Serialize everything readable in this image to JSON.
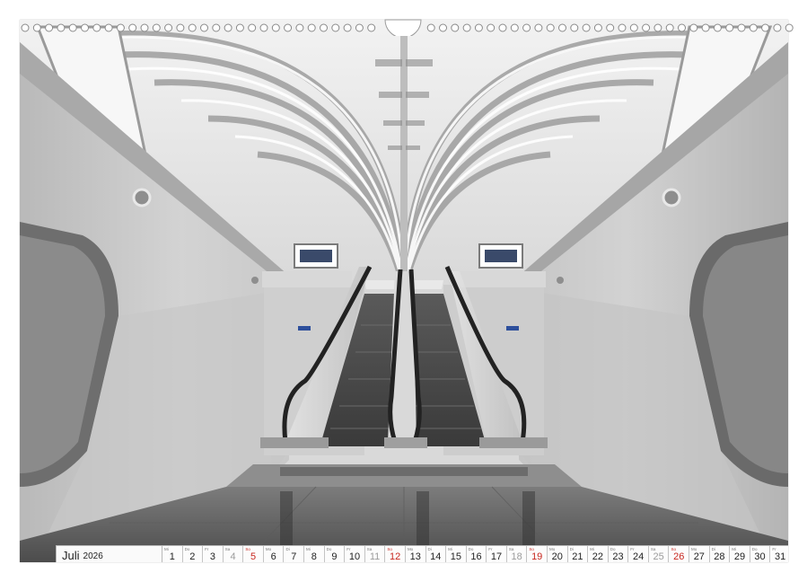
{
  "calendar": {
    "month": "Juli",
    "year": "2026",
    "days": [
      {
        "wd": "Mi",
        "n": "1",
        "t": "w"
      },
      {
        "wd": "Do",
        "n": "2",
        "t": "w"
      },
      {
        "wd": "Fr",
        "n": "3",
        "t": "w"
      },
      {
        "wd": "Sa",
        "n": "4",
        "t": "sat"
      },
      {
        "wd": "So",
        "n": "5",
        "t": "sun"
      },
      {
        "wd": "Mo",
        "n": "6",
        "t": "w"
      },
      {
        "wd": "Di",
        "n": "7",
        "t": "w"
      },
      {
        "wd": "Mi",
        "n": "8",
        "t": "w"
      },
      {
        "wd": "Do",
        "n": "9",
        "t": "w"
      },
      {
        "wd": "Fr",
        "n": "10",
        "t": "w"
      },
      {
        "wd": "Sa",
        "n": "11",
        "t": "sat"
      },
      {
        "wd": "So",
        "n": "12",
        "t": "sun"
      },
      {
        "wd": "Mo",
        "n": "13",
        "t": "w"
      },
      {
        "wd": "Di",
        "n": "14",
        "t": "w"
      },
      {
        "wd": "Mi",
        "n": "15",
        "t": "w"
      },
      {
        "wd": "Do",
        "n": "16",
        "t": "w"
      },
      {
        "wd": "Fr",
        "n": "17",
        "t": "w"
      },
      {
        "wd": "Sa",
        "n": "18",
        "t": "sat"
      },
      {
        "wd": "So",
        "n": "19",
        "t": "sun"
      },
      {
        "wd": "Mo",
        "n": "20",
        "t": "w"
      },
      {
        "wd": "Di",
        "n": "21",
        "t": "w"
      },
      {
        "wd": "Mi",
        "n": "22",
        "t": "w"
      },
      {
        "wd": "Do",
        "n": "23",
        "t": "w"
      },
      {
        "wd": "Fr",
        "n": "24",
        "t": "w"
      },
      {
        "wd": "Sa",
        "n": "25",
        "t": "sat"
      },
      {
        "wd": "So",
        "n": "26",
        "t": "sun"
      },
      {
        "wd": "Mo",
        "n": "27",
        "t": "w"
      },
      {
        "wd": "Di",
        "n": "28",
        "t": "w"
      },
      {
        "wd": "Mi",
        "n": "29",
        "t": "w"
      },
      {
        "wd": "Do",
        "n": "30",
        "t": "w"
      },
      {
        "wd": "Fr",
        "n": "31",
        "t": "w"
      }
    ]
  },
  "colors": {
    "sunday": "#c8261e",
    "saturday": "#9b9b9b",
    "weekday": "#222222"
  },
  "icons": {
    "binding": "spiral-binding-icon",
    "hanger": "hanger-notch-icon"
  }
}
